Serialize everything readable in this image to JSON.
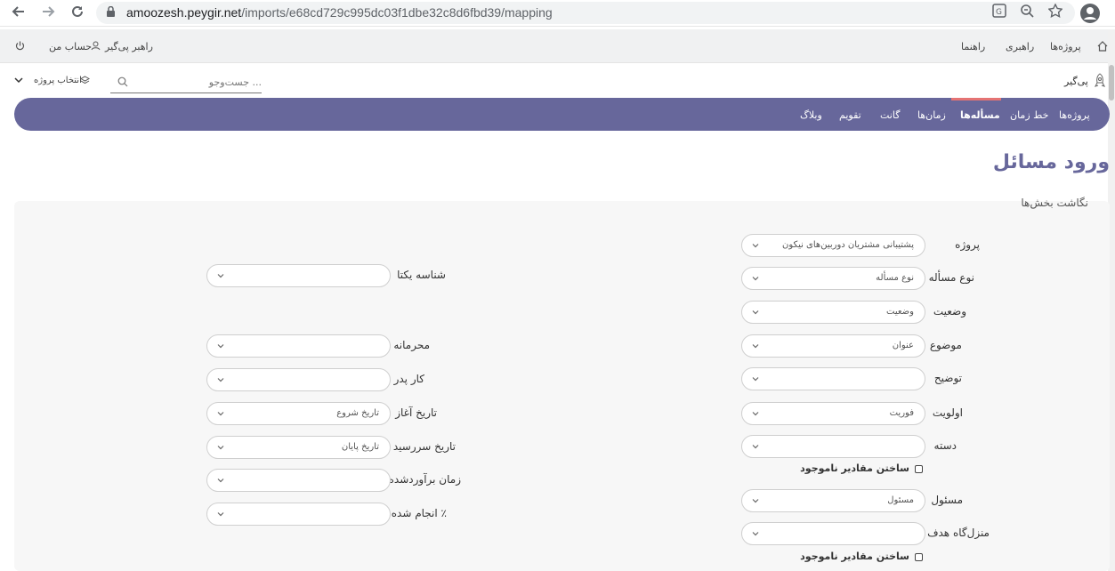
{
  "browser": {
    "url_host": "amoozesh.peygir.net",
    "url_path": "/imports/e68cd729c995dc03f1dbe32c8d6fbd39/mapping",
    "icons": [
      "back-icon",
      "forward-icon",
      "reload-icon",
      "lock-icon",
      "translate-icon",
      "zoom-icon",
      "star-icon",
      "profile-icon"
    ]
  },
  "top_menu": {
    "projects": "پروژه‌ها",
    "guide": "راهبری",
    "help": "راهنما",
    "user": "راهبر پی‌گیر",
    "account": "حساب من"
  },
  "search": {
    "brand": "پی‌گیر",
    "placeholder": "... جست‌وجو",
    "project_select": "انتخاب پروژه"
  },
  "nav": {
    "items": [
      "پروژه‌ها",
      "خط زمان",
      "مسأله‌ها",
      "زمان‌ها",
      "گانت",
      "تقویم",
      "وبلاگ"
    ],
    "active_index": 2
  },
  "page": {
    "title": "ورود مسائل",
    "panel_title": "نگاشت بخش‌ها"
  },
  "right_fields": [
    {
      "label": "پروژه",
      "value": "پشتیبانی مشتریان دوربین‌های نیکون"
    },
    {
      "label": "نوع مسأله",
      "value": "نوع مسأله"
    },
    {
      "label": "وضعیت",
      "value": "وضعیت"
    },
    {
      "label": "موضوع",
      "value": "عنوان"
    },
    {
      "label": "توضیح",
      "value": ""
    },
    {
      "label": "اولویت",
      "value": "فوریت"
    },
    {
      "label": "دسته",
      "value": ""
    },
    {
      "label": "مسئول",
      "value": "مسئول"
    },
    {
      "label": "منزل‌گاه هدف",
      "value": ""
    }
  ],
  "left_fields": [
    {
      "label": "شناسه یکتا",
      "value": ""
    },
    {
      "label": "محرمانه",
      "value": ""
    },
    {
      "label": "کار پدر",
      "value": ""
    },
    {
      "label": "تاریخ آغاز",
      "value": "تاریخ شروع"
    },
    {
      "label": "تاریخ سررسید",
      "value": "تاریخ پایان"
    },
    {
      "label": "زمان برآوردشده",
      "value": ""
    },
    {
      "label": "٪ انجام شده",
      "value": ""
    }
  ],
  "checkboxes": {
    "create_missing_1": "ساختن مقادیر ناموجود",
    "create_missing_2": "ساختن مقادیر ناموجود"
  },
  "colors": {
    "nav_bg": "#67679b",
    "active_underline": "#e57373",
    "title": "#67679b"
  }
}
